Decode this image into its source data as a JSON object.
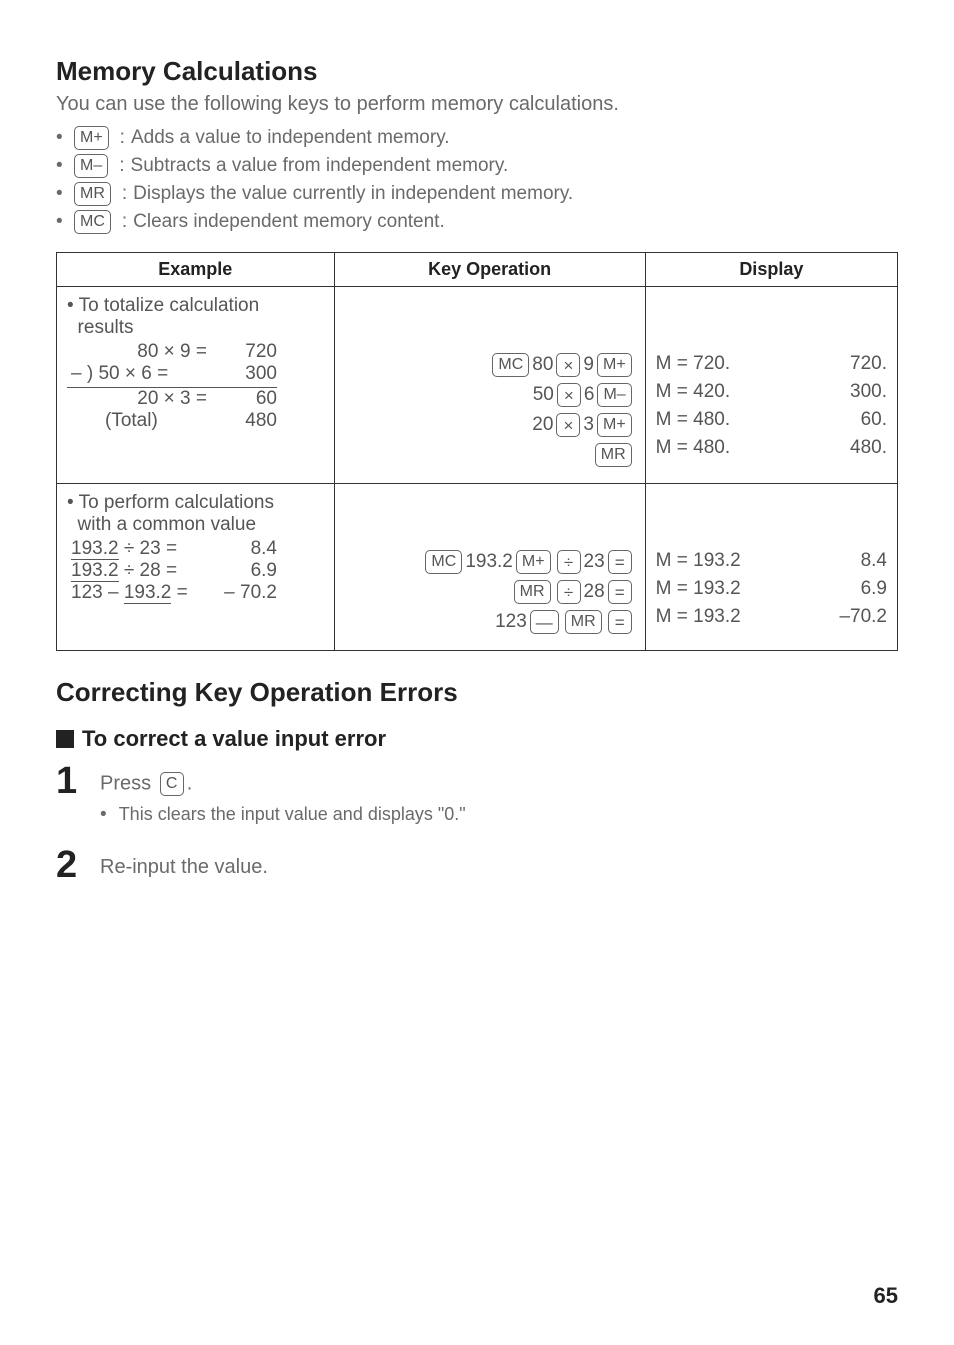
{
  "section1": {
    "title": "Memory Calculations",
    "intro": "You can use the following keys to perform memory calculations.",
    "bullets": [
      {
        "key": "M+",
        "desc": "Adds a value to independent memory."
      },
      {
        "key": "M–",
        "desc": "Subtracts a value from independent memory."
      },
      {
        "key": "MR",
        "desc": "Displays the value currently in independent memory."
      },
      {
        "key": "MC",
        "desc": "Clears independent memory content."
      }
    ]
  },
  "table": {
    "headers": {
      "example": "Example",
      "keyop": "Key Operation",
      "display": "Display"
    },
    "row1": {
      "label": "• To totalize calculation results",
      "lines": [
        {
          "expr": "80 × 9 =",
          "res": "720"
        },
        {
          "expr": "– ) 50 × 6 =",
          "res": "300"
        },
        {
          "expr": "20 × 3 =",
          "res": "60"
        },
        {
          "expr": "(Total)",
          "res": "480"
        }
      ],
      "ops": {
        "n80": "80",
        "n9": "9",
        "n50": "50",
        "n6": "6",
        "n20": "20",
        "n3": "3",
        "MC": "MC",
        "Mplus": "M+",
        "Mminus": "M–",
        "MR": "MR",
        "x": "×"
      },
      "disp": [
        {
          "l": "M = 720.",
          "r": "720."
        },
        {
          "l": "M = 420.",
          "r": "300."
        },
        {
          "l": "M = 480.",
          "r": "60."
        },
        {
          "l": "M = 480.",
          "r": "480."
        }
      ]
    },
    "row2": {
      "label": "• To perform calculations with a common value",
      "lines": [
        {
          "expr": "193.2 ÷ 23 =",
          "res": "8.4"
        },
        {
          "expr": "193.2 ÷ 28 =",
          "res": "6.9"
        },
        {
          "expr": "123 – 193.2 =",
          "res": "– 70.2"
        }
      ],
      "ops": {
        "n1932": "193.2",
        "n23": "23",
        "n28": "28",
        "n123": "123",
        "MC": "MC",
        "Mplus": "M+",
        "MR": "MR",
        "div": "÷",
        "minus": "—",
        "eq": "="
      },
      "disp": [
        {
          "l": "M = 193.2",
          "r": "8.4"
        },
        {
          "l": "M = 193.2",
          "r": "6.9"
        },
        {
          "l": "M = 193.2",
          "r": "–70.2"
        }
      ]
    }
  },
  "section2": {
    "title": "Correcting Key Operation Errors",
    "sub": "To correct a value input error",
    "step1": {
      "num": "1",
      "text_a": "Press ",
      "key": "C",
      "text_b": ".",
      "sub": "This clears the input value and displays \"0.\""
    },
    "step2": {
      "num": "2",
      "text": "Re-input the value."
    }
  },
  "pagenum": "65"
}
